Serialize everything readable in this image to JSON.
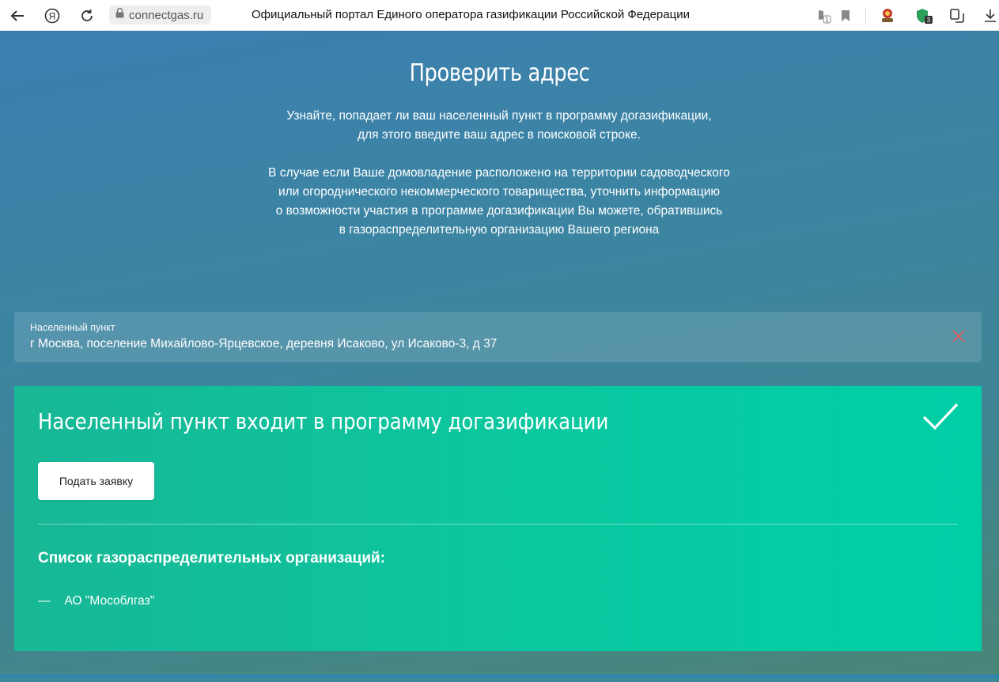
{
  "browser": {
    "domain": "connectgas.ru",
    "title": "Официальный портал Единого оператора газификации Российской Федерации",
    "yandex_glyph": "Я",
    "ext_badge_1": "1",
    "ext_badge_2": "3",
    "icons": [
      "back-icon",
      "yandex-icon",
      "reload-icon",
      "lock-icon",
      "translate-icon",
      "bookmark-icon",
      "extension-icon",
      "shield-icon",
      "collections-icon",
      "download-icon"
    ]
  },
  "hero": {
    "title": "Проверить адрес",
    "p1_line1": "Узнайте, попадает ли ваш населенный пункт в программу догазификации,",
    "p1_line2": "для этого введите ваш адрес в поисковой строке.",
    "p2_line1": "В случае если Ваше домовладение расположено на территории садоводческого",
    "p2_line2": "или огороднического некоммерческого товарищества, уточнить информацию",
    "p2_line3": "о возможности участия в программе догазификации Вы можете, обратившись",
    "p2_line4": "в газораспределительную организацию Вашего региона"
  },
  "search": {
    "label": "Населенный пункт",
    "value": "г Москва, поселение Михайлово-Ярцевское, деревня Исаково, ул Исаково-3, д 37",
    "clear_color": "#e05a5a"
  },
  "result": {
    "title": "Населенный пункт входит в программу догазификации",
    "apply_button": "Подать заявку",
    "list_title": "Список газораспределительных организаций:",
    "orgs": [
      {
        "dash": "—",
        "name": "АО \"Мособлгаз\""
      }
    ],
    "accent": "#00cfa6"
  }
}
